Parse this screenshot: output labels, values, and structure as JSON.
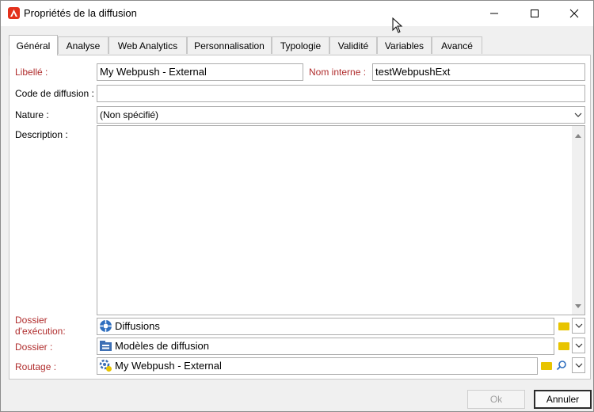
{
  "window": {
    "title": "Propriétés de la diffusion"
  },
  "tabs": [
    "Général",
    "Analyse",
    "Web Analytics",
    "Personnalisation",
    "Typologie",
    "Validité",
    "Variables",
    "Avancé"
  ],
  "form": {
    "libelle_label": "Libellé :",
    "libelle_value": "My Webpush - External",
    "nom_interne_label": "Nom interne :",
    "nom_interne_value": "testWebpushExt",
    "code_label": "Code de diffusion :",
    "code_value": "",
    "nature_label": "Nature :",
    "nature_value": "(Non spécifié)",
    "description_label": "Description :",
    "description_value": "",
    "dossier_exec_label_1": "Dossier",
    "dossier_exec_label_2": "d'exécution:",
    "dossier_exec_value": "Diffusions",
    "dossier_label": "Dossier :",
    "dossier_value": "Modèles de diffusion",
    "routage_label": "Routage :",
    "routage_value": "My Webpush - External"
  },
  "buttons": {
    "ok": "Ok",
    "cancel": "Annuler"
  },
  "colors": {
    "red_label": "#b02d2d",
    "app_icon": "#e3311c",
    "folder": "#e8c400"
  }
}
